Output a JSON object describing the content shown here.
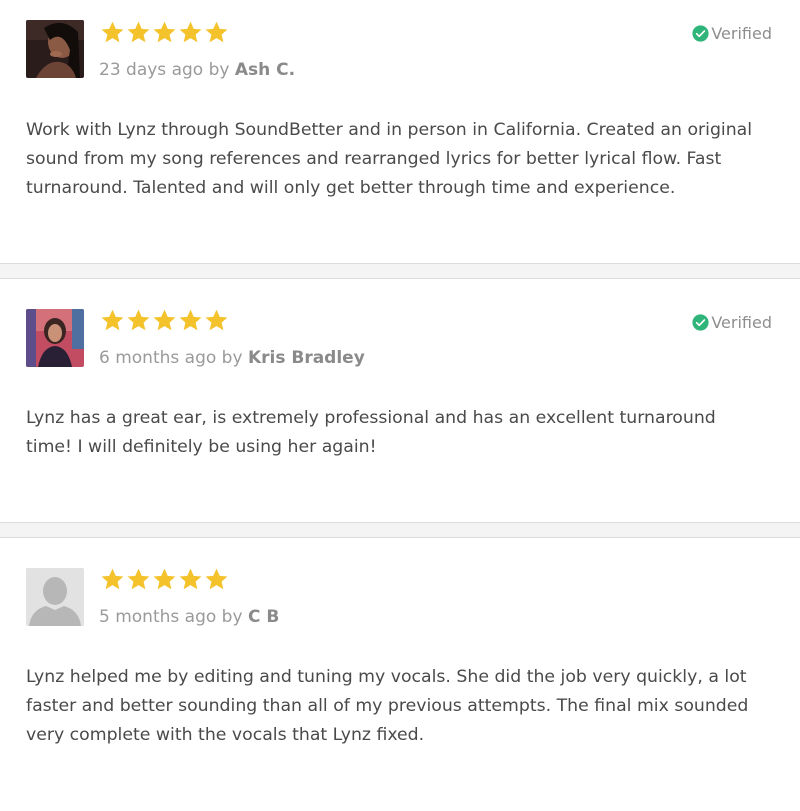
{
  "reviews": [
    {
      "rating": 5,
      "time_ago": "23 days ago",
      "by": "by",
      "reviewer": "Ash C.",
      "verified_label": "Verified",
      "avatar_icon": "user-photo",
      "text": "Work with Lynz through SoundBetter and in person in California. Created an original sound from my song references and rearranged lyrics for better lyrical flow. Fast turnaround. Talented and will only get better through time and experience."
    },
    {
      "rating": 5,
      "time_ago": "6 months ago",
      "by": "by",
      "reviewer": "Kris Bradley",
      "verified_label": "Verified",
      "avatar_icon": "user-photo",
      "text": "Lynz has a great ear, is extremely professional and has an excellent turnaround time! I will definitely be using her again!"
    },
    {
      "rating": 5,
      "time_ago": "5 months ago",
      "by": "by",
      "reviewer": "C B",
      "avatar_icon": "default-user-silhouette",
      "text": "Lynz helped me by editing and tuning my vocals. She did the job very quickly, a lot faster and better sounding than all of my previous attempts. The final mix sounded very complete with the vocals that Lynz fixed."
    }
  ],
  "colors": {
    "star": "#f4c22b",
    "verified": "#2fb57a",
    "separator": "#f4f4f4"
  }
}
